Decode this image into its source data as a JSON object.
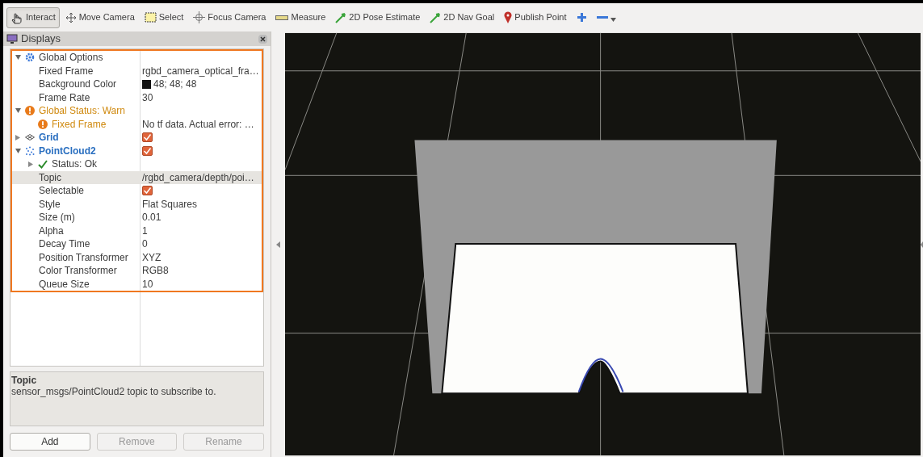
{
  "toolbar": {
    "tools": [
      {
        "kind": "interact",
        "label": "Interact",
        "selected": true
      },
      {
        "kind": "move",
        "label": "Move Camera",
        "selected": false
      },
      {
        "kind": "select",
        "label": "Select",
        "selected": false
      },
      {
        "kind": "focus",
        "label": "Focus Camera",
        "selected": false
      },
      {
        "kind": "measure",
        "label": "Measure",
        "selected": false
      },
      {
        "kind": "pose",
        "label": "2D Pose Estimate",
        "selected": false
      },
      {
        "kind": "nav",
        "label": "2D Nav Goal",
        "selected": false
      },
      {
        "kind": "point",
        "label": "Publish Point",
        "selected": false
      },
      {
        "kind": "add",
        "selected": false
      },
      {
        "kind": "remove",
        "selected": false,
        "has_menu": true
      }
    ]
  },
  "displays": {
    "title": "Displays",
    "tree": [
      {
        "label": "Global Options",
        "kind": "options",
        "expanded": true,
        "selected": false,
        "children": [
          {
            "label": "Fixed Frame",
            "value": "rgbd_camera_optical_fra…",
            "selected": false
          },
          {
            "label": "Background Color",
            "value": "48; 48; 48",
            "color": "#111111",
            "selected": false
          },
          {
            "label": "Frame Rate",
            "value": "30",
            "selected": false
          }
        ]
      },
      {
        "label": "Global Status: Warn",
        "kind": "warning",
        "expanded": true,
        "selected": false,
        "children": [
          {
            "label": "Fixed Frame",
            "kind": "warning",
            "value": "No tf data.  Actual error: …",
            "selected": false
          }
        ]
      },
      {
        "label": "Grid",
        "kind": "grid",
        "expanded": false,
        "checked": true,
        "selected": false
      },
      {
        "label": "PointCloud2",
        "kind": "pointcloud",
        "expanded": true,
        "checked": true,
        "selected": false,
        "children": [
          {
            "label": "Status: Ok",
            "kind": "status",
            "expanded": false,
            "selected": false
          },
          {
            "label": "Topic",
            "value": "/rgbd_camera/depth/poi…",
            "selected": true
          },
          {
            "label": "Selectable",
            "checked": true,
            "selected": false
          },
          {
            "label": "Style",
            "value": "Flat Squares",
            "selected": false
          },
          {
            "label": "Size (m)",
            "value": "0.01",
            "selected": false
          },
          {
            "label": "Alpha",
            "value": "1",
            "selected": false
          },
          {
            "label": "Decay Time",
            "value": "0",
            "selected": false
          },
          {
            "label": "Position Transformer",
            "value": "XYZ",
            "selected": false
          },
          {
            "label": "Color Transformer",
            "value": "RGB8",
            "selected": false
          },
          {
            "label": "Queue Size",
            "value": "10",
            "selected": false
          }
        ]
      }
    ],
    "description": {
      "title": "Topic",
      "text": "sensor_msgs/PointCloud2 topic to subscribe to."
    },
    "buttons": [
      {
        "label": "Add",
        "disabled": false
      },
      {
        "label": "Remove",
        "disabled": true
      },
      {
        "label": "Rename",
        "disabled": true
      }
    ]
  }
}
